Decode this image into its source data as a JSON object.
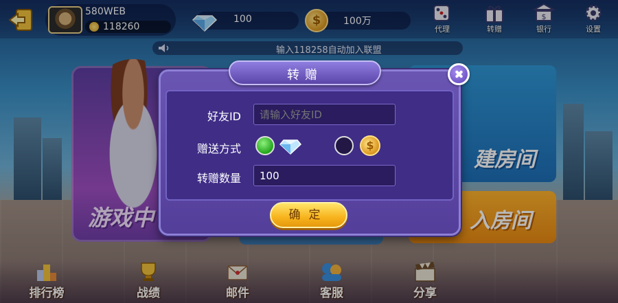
{
  "colors": {
    "accent_purple": "#533f9a",
    "confirm_gold": "#f7b31d",
    "radio_green": "#22a51c"
  },
  "player": {
    "name": "580WEB",
    "score": "118260"
  },
  "stats": {
    "diamonds": "100",
    "gold": "100万"
  },
  "top_menu": [
    {
      "label": "代理",
      "icon": "dice-icon"
    },
    {
      "label": "转赠",
      "icon": "gift-icon"
    },
    {
      "label": "银行",
      "icon": "bank-icon"
    },
    {
      "label": "设置",
      "icon": "gear-icon"
    }
  ],
  "marquee": "输入118258自动加入联盟",
  "background_panels": {
    "left": "游戏中",
    "right_top": "建房间",
    "right_bottom": "入房间"
  },
  "bottom_nav": [
    {
      "label": "排行榜",
      "icon": "trophy-rank-icon"
    },
    {
      "label": "战绩",
      "icon": "cup-icon"
    },
    {
      "label": "邮件",
      "icon": "mail-icon"
    },
    {
      "label": "客服",
      "icon": "service-icon"
    },
    {
      "label": "分享",
      "icon": "clapper-icon"
    }
  ],
  "dialog": {
    "title": "转赠",
    "friend_id_label": "好友ID",
    "friend_id_placeholder": "请输入好友ID",
    "method_label": "赠送方式",
    "method_selected": "diamond",
    "amount_label": "转赠数量",
    "amount_value": "100",
    "confirm_label": "确定"
  }
}
